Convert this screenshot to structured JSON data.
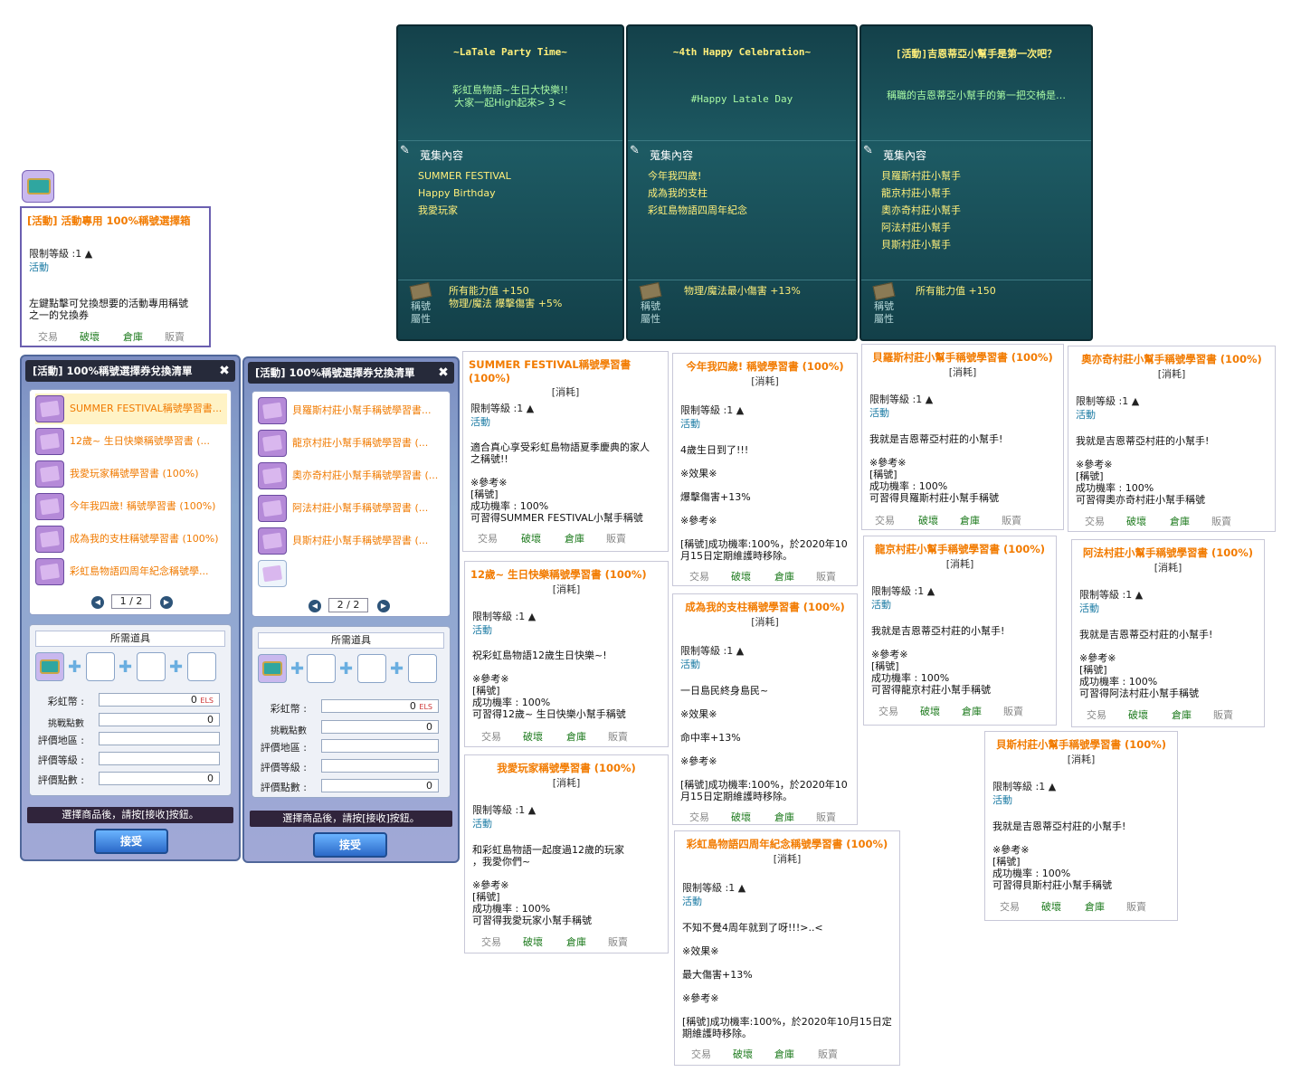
{
  "title_cards": [
    {
      "title": "~LaTale Party Time~",
      "desc": "彩虹島物語~生日大快樂!!\n大家一起High起來> 3 <",
      "collect_label": "蒐集內容",
      "items": [
        "SUMMER FESTIVAL",
        "Happy Birthday",
        "我愛玩家"
      ],
      "attr_label": "稱號\n屬性",
      "stats": "所有能力值 +150\n物理/魔法 爆擊傷害 +5%"
    },
    {
      "title": "~4th Happy Celebration~",
      "desc": "#Happy Latale Day",
      "collect_label": "蒐集內容",
      "items": [
        "今年我四歲!",
        "成為我的支柱",
        "彩虹島物語四周年紀念"
      ],
      "attr_label": "稱號\n屬性",
      "stats": "物理/魔法最小傷害 +13%"
    },
    {
      "title": "[活動]吉恩蒂亞小幫手是第一次吧？",
      "desc": "稱職的吉恩蒂亞小幫手的第一把交椅是…",
      "collect_label": "蒐集內容",
      "items": [
        "貝羅斯村莊小幫手",
        "龍京村莊小幫手",
        "奧亦奇村莊小幫手",
        "阿法村莊小幫手",
        "貝斯村莊小幫手"
      ],
      "attr_label": "稱號\n屬性",
      "stats": "所有能力值 +150"
    }
  ],
  "box_tooltip": {
    "name": "[活動] 活動專用 100%稱號選擇箱",
    "level": "限制等級 :1 ▲",
    "event": "活動",
    "body": "左鍵點擊可兌換想要的活動專用稱號\n之一的兌換券",
    "trade": "交易",
    "break": "破壞",
    "store": "倉庫",
    "sell": "販賣"
  },
  "window1": {
    "title": "[活動] 100%稱號選擇券兌換清單",
    "items": [
      "SUMMER FESTIVAL稱號學習書...",
      "12歲~ 生日快樂稱號學習書 (...",
      "我愛玩家稱號學習書 (100%)",
      "今年我四歲! 稱號學習書 (100%)",
      "成為我的支柱稱號學習書 (100%)",
      "彩虹島物語四周年紀念稱號學..."
    ],
    "page": "1 / 2",
    "req_title": "所需道具",
    "rainbow_label": "彩虹幣 :",
    "rainbow_val": "0",
    "challenge_label": "挑戰點數",
    "challenge_val": "0",
    "area_label": "評價地區 :",
    "grade_label": "評價等級 :",
    "points_label": "評價點數 :",
    "points_val": "0",
    "hint": "選擇商品後，請按[接收]按鈕。",
    "accept": "接受"
  },
  "window2": {
    "title": "[活動] 100%稱號選擇券兌換清單",
    "items": [
      "貝羅斯村莊小幫手稱號學習書...",
      "龍京村莊小幫手稱號學習書 (...",
      "奧亦奇村莊小幫手稱號學習書 (...",
      "阿法村莊小幫手稱號學習書 (...",
      "貝斯村莊小幫手稱號學習書 (..."
    ],
    "page": "2 / 2",
    "req_title": "所需道具",
    "rainbow_label": "彩虹幣 :",
    "rainbow_val": "0",
    "challenge_label": "挑戰點數",
    "challenge_val": "0",
    "area_label": "評價地區 :",
    "grade_label": "評價等級 :",
    "points_label": "評價點數 :",
    "points_val": "0",
    "hint": "選擇商品後，請按[接收]按鈕。",
    "accept": "接受"
  },
  "book_tooltips": [
    {
      "name": "SUMMER FESTIVAL稱號學習書 (100%)",
      "consume": "[消耗]",
      "level": "限制等級 :1 ▲",
      "event": "活動",
      "body": "適合真心享受彩虹島物語夏季慶典的家人\n之稱號!!\n\n※參考※\n[稱號]\n成功機率 : 100%\n可習得SUMMER FESTIVAL小幫手稱號",
      "trade": "交易",
      "break": "破壞",
      "store": "倉庫",
      "sell": "販賣"
    },
    {
      "name": "12歲~ 生日快樂稱號學習書 (100%)",
      "consume": "[消耗]",
      "level": "限制等級 :1 ▲",
      "event": "活動",
      "body": "祝彩虹島物語12歲生日快樂~!\n\n※參考※\n[稱號]\n成功機率 : 100%\n可習得12歲~ 生日快樂小幫手稱號",
      "trade": "交易",
      "break": "破壞",
      "store": "倉庫",
      "sell": "販賣"
    },
    {
      "name": "我愛玩家稱號學習書 (100%)",
      "consume": "[消耗]",
      "level": "限制等級 :1 ▲",
      "event": "活動",
      "body": "和彩虹島物語一起度過12歲的玩家\n，我愛你們~\n\n※參考※\n[稱號]\n成功機率 : 100%\n可習得我愛玩家小幫手稱號",
      "trade": "交易",
      "break": "破壞",
      "store": "倉庫",
      "sell": "販賣"
    },
    {
      "name": "今年我四歲! 稱號學習書 (100%)",
      "consume": "[消耗]",
      "level": "限制等級 :1 ▲",
      "event": "活動",
      "body": "4歲生日到了!!!\n\n※效果※\n\n爆擊傷害+13%\n\n※參考※\n\n[稱號]成功機率:100%，於2020年10\n月15日定期維護時移除。",
      "trade": "交易",
      "break": "破壞",
      "store": "倉庫",
      "sell": "販賣"
    },
    {
      "name": "成為我的支柱稱號學習書 (100%)",
      "consume": "[消耗]",
      "level": "限制等級 :1 ▲",
      "event": "活動",
      "body": "一日島民終身島民~\n\n※效果※\n\n命中率+13%\n\n※參考※\n\n[稱號]成功機率:100%，於2020年10\n月15日定期維護時移除。",
      "trade": "交易",
      "break": "破壞",
      "store": "倉庫",
      "sell": "販賣"
    },
    {
      "name": "彩虹島物語四周年紀念稱號學習書 (100%)",
      "consume": "[消耗]",
      "level": "限制等級 :1 ▲",
      "event": "活動",
      "body": "不知不覺4周年就到了呀!!!>..<\n\n※效果※\n\n最大傷害+13%\n\n※參考※\n\n[稱號]成功機率:100%，於2020年10月15日定\n期維護時移除。",
      "trade": "交易",
      "break": "破壞",
      "store": "倉庫",
      "sell": "販賣"
    },
    {
      "name": "貝羅斯村莊小幫手稱號學習書 (100%)",
      "consume": "[消耗]",
      "level": "限制等級 :1 ▲",
      "event": "活動",
      "body": "我就是吉恩蒂亞村莊的小幫手!\n\n※參考※\n[稱號]\n成功機率 : 100%\n可習得貝羅斯村莊小幫手稱號",
      "trade": "交易",
      "break": "破壞",
      "store": "倉庫",
      "sell": "販賣"
    },
    {
      "name": "奧亦奇村莊小幫手稱號學習書 (100%)",
      "consume": "[消耗]",
      "level": "限制等級 :1 ▲",
      "event": "活動",
      "body": "我就是吉恩蒂亞村莊的小幫手!\n\n※參考※\n[稱號]\n成功機率 : 100%\n可習得奧亦奇村莊小幫手稱號",
      "trade": "交易",
      "break": "破壞",
      "store": "倉庫",
      "sell": "販賣"
    },
    {
      "name": "龍京村莊小幫手稱號學習書 (100%)",
      "consume": "[消耗]",
      "level": "限制等級 :1 ▲",
      "event": "活動",
      "body": "我就是吉恩蒂亞村莊的小幫手!\n\n※參考※\n[稱號]\n成功機率 : 100%\n可習得龍京村莊小幫手稱號",
      "trade": "交易",
      "break": "破壞",
      "store": "倉庫",
      "sell": "販賣"
    },
    {
      "name": "阿法村莊小幫手稱號學習書 (100%)",
      "consume": "[消耗]",
      "level": "限制等級 :1 ▲",
      "event": "活動",
      "body": "我就是吉恩蒂亞村莊的小幫手!\n\n※參考※\n[稱號]\n成功機率 : 100%\n可習得阿法村莊小幫手稱號",
      "trade": "交易",
      "break": "破壞",
      "store": "倉庫",
      "sell": "販賣"
    },
    {
      "name": "貝斯村莊小幫手稱號學習書 (100%)",
      "consume": "[消耗]",
      "level": "限制等級 :1 ▲",
      "event": "活動",
      "body": "我就是吉恩蒂亞村莊的小幫手!\n\n※參考※\n[稱號]\n成功機率 : 100%\n可習得貝斯村莊小幫手稱號",
      "trade": "交易",
      "break": "破壞",
      "store": "倉庫",
      "sell": "販賣"
    }
  ]
}
